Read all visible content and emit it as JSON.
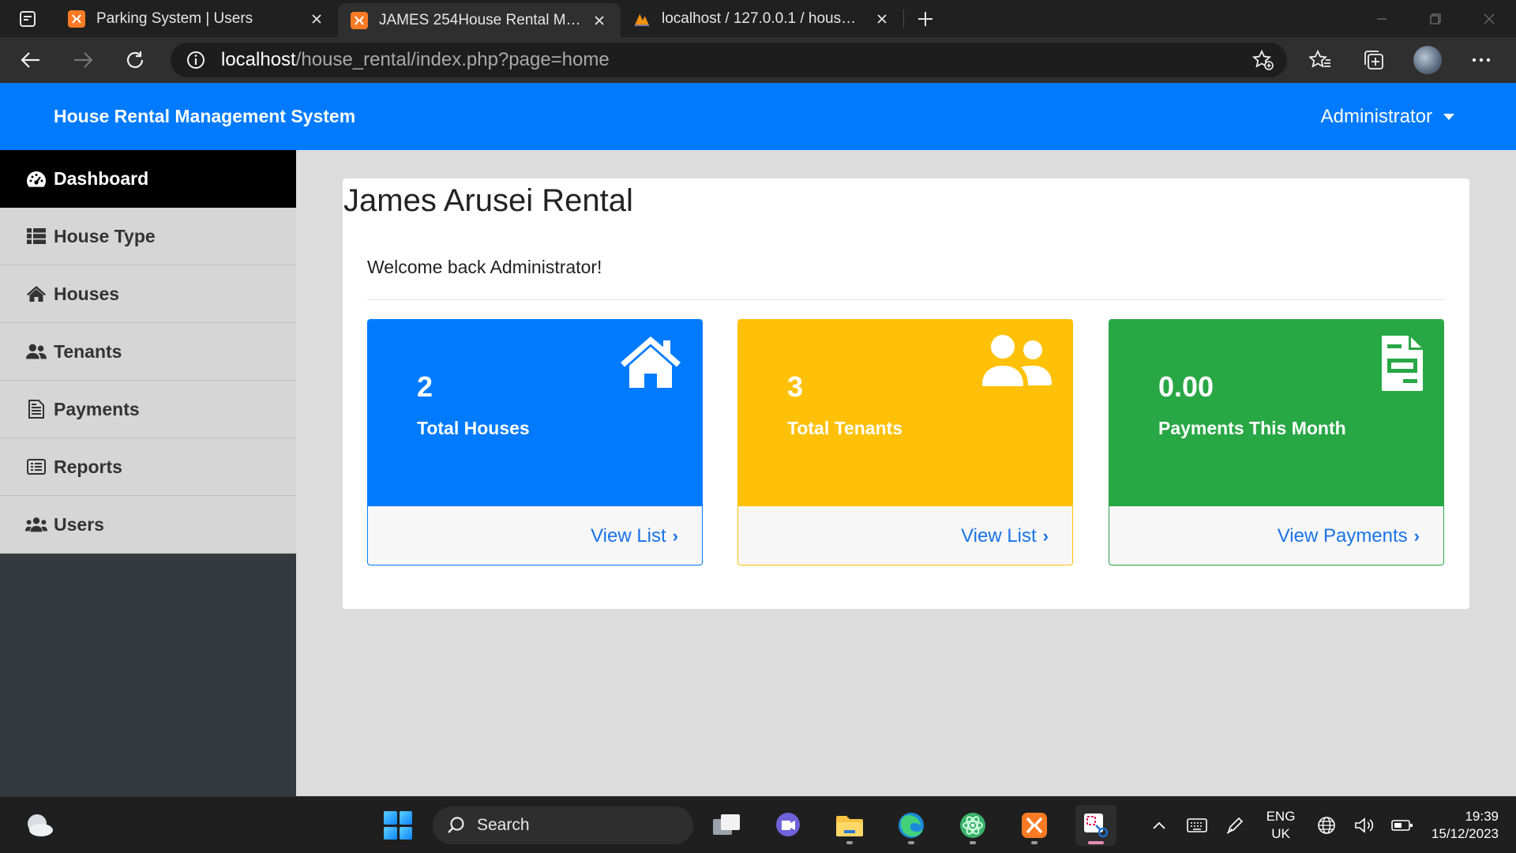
{
  "browser": {
    "tabs": [
      {
        "title": "Parking System | Users",
        "active": false
      },
      {
        "title": "JAMES 254House Rental Management System",
        "active": true
      },
      {
        "title": "localhost / 127.0.0.1 / house_rental",
        "active": false
      }
    ],
    "url_host": "localhost",
    "url_path": "/house_rental/index.php?page=home"
  },
  "navbar": {
    "brand": "House Rental Management System",
    "user": "Administrator"
  },
  "sidebar": {
    "items": [
      {
        "label": "Dashboard",
        "icon": "dashboard-icon",
        "active": true
      },
      {
        "label": "House Type",
        "icon": "list-icon"
      },
      {
        "label": "Houses",
        "icon": "home-icon"
      },
      {
        "label": "Tenants",
        "icon": "tenants-icon"
      },
      {
        "label": "Payments",
        "icon": "file-invoice-icon"
      },
      {
        "label": "Reports",
        "icon": "list-alt-icon"
      },
      {
        "label": "Users",
        "icon": "users-icon"
      }
    ]
  },
  "main": {
    "title": "James Arusei Rental",
    "welcome": "Welcome back Administrator!",
    "stats": [
      {
        "value": "2",
        "label": "Total Houses",
        "link": "View List",
        "color": "#007bff",
        "icon": "house-icon"
      },
      {
        "value": "3",
        "label": "Total Tenants",
        "link": "View List",
        "color": "#ffc107",
        "icon": "user-friends-icon"
      },
      {
        "value": "0.00",
        "label": "Payments This Month",
        "link": "View Payments",
        "color": "#28a745",
        "icon": "receipt-icon"
      }
    ]
  },
  "taskbar": {
    "search_label": "Search",
    "lang_line1": "ENG",
    "lang_line2": "UK",
    "time": "19:39",
    "date": "15/12/2023"
  }
}
